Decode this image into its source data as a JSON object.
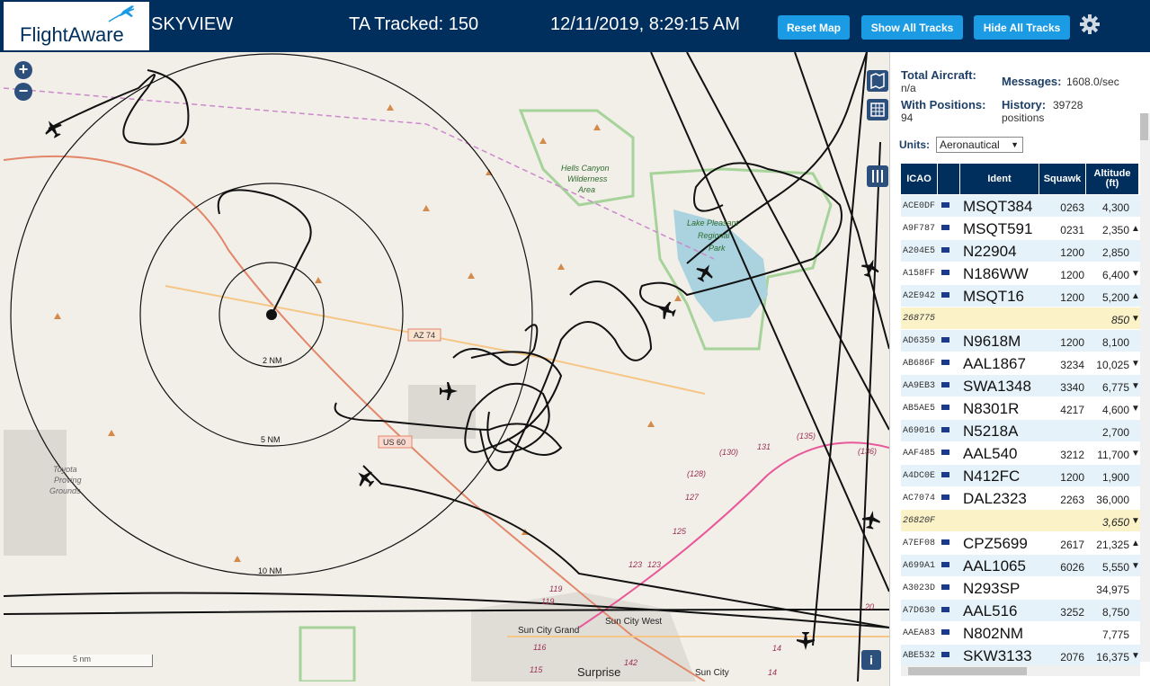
{
  "header": {
    "logo": "FlightAware",
    "site_name": "SKYVIEW",
    "tracked": "TA Tracked: 150",
    "datetime": "12/11/2019, 8:29:15 AM",
    "buttons": {
      "reset_map": "Reset Map",
      "show_all_tracks": "Show All Tracks",
      "hide_all_tracks": "Hide All Tracks"
    }
  },
  "map": {
    "range_rings": [
      "2 NM",
      "5 NM",
      "10 NM"
    ],
    "scale": "5 nm",
    "labels": {
      "hells_canyon": [
        "Hells Canyon",
        "Wilderness",
        "Area"
      ],
      "lake_pleasant": [
        "Lake Pleasant",
        "Regional",
        "Park"
      ],
      "toyota": [
        "Toyota",
        "Proving",
        "Grounds"
      ],
      "az74": "AZ 74",
      "us60": "US 60",
      "sun_city_grand": "Sun City Grand",
      "sun_city_west": "Sun City West",
      "surprise": "Surprise",
      "sun_city": "Sun City",
      "r119a": "119",
      "r119b": "119",
      "r116": "116",
      "r115": "115",
      "r142": "142",
      "r123a": "123",
      "r123b": "123",
      "r125": "125",
      "r127": "127",
      "r128": "(128)",
      "r130": "(130)",
      "r131": "131",
      "r135": "(135)",
      "r136": "(136)",
      "r14a": "14",
      "r14b": "14",
      "r20": "20"
    },
    "info_icon": "i"
  },
  "panel": {
    "total_aircraft_label": "Total Aircraft:",
    "total_aircraft_value": "n/a",
    "messages_label": "Messages:",
    "messages_value": "1608.0/sec",
    "with_positions_label": "With Positions:",
    "with_positions_value": "94",
    "history_label": "History:",
    "history_value_1": "39728",
    "history_value_2": "positions",
    "units_label": "Units:",
    "units_value": "Aeronautical"
  },
  "table": {
    "headers": {
      "icao": "ICAO",
      "ident": "Ident",
      "squawk": "Squawk",
      "altitude": "Altitude (ft)"
    },
    "rows": [
      {
        "icao": "ACE0DF",
        "flag": true,
        "ident": "MSQT384",
        "squawk": "0263",
        "altitude": "4,300",
        "trend": ""
      },
      {
        "icao": "A9F787",
        "flag": true,
        "ident": "MSQT591",
        "squawk": "0231",
        "altitude": "2,350",
        "trend": "▲"
      },
      {
        "icao": "A204E5",
        "flag": true,
        "ident": "N22904",
        "squawk": "1200",
        "altitude": "2,850",
        "trend": ""
      },
      {
        "icao": "A158FF",
        "flag": true,
        "ident": "N186WW",
        "squawk": "1200",
        "altitude": "6,400",
        "trend": "▼"
      },
      {
        "icao": "A2E942",
        "flag": true,
        "ident": "MSQT16",
        "squawk": "1200",
        "altitude": "5,200",
        "trend": "▲"
      },
      {
        "icao": "268775",
        "flag": false,
        "ident": "",
        "squawk": "",
        "altitude": "850",
        "trend": "▼"
      },
      {
        "icao": "AD6359",
        "flag": true,
        "ident": "N9618M",
        "squawk": "1200",
        "altitude": "8,100",
        "trend": ""
      },
      {
        "icao": "AB686F",
        "flag": true,
        "ident": "AAL1867",
        "squawk": "3234",
        "altitude": "10,025",
        "trend": "▼"
      },
      {
        "icao": "AA9EB3",
        "flag": true,
        "ident": "SWA1348",
        "squawk": "3340",
        "altitude": "6,775",
        "trend": "▼"
      },
      {
        "icao": "AB5AE5",
        "flag": true,
        "ident": "N8301R",
        "squawk": "4217",
        "altitude": "4,600",
        "trend": "▼"
      },
      {
        "icao": "A69016",
        "flag": true,
        "ident": "N5218A",
        "squawk": "",
        "altitude": "2,700",
        "trend": ""
      },
      {
        "icao": "AAF485",
        "flag": true,
        "ident": "AAL540",
        "squawk": "3212",
        "altitude": "11,700",
        "trend": "▼"
      },
      {
        "icao": "A4DC0E",
        "flag": true,
        "ident": "N412FC",
        "squawk": "1200",
        "altitude": "1,900",
        "trend": ""
      },
      {
        "icao": "AC7074",
        "flag": true,
        "ident": "DAL2323",
        "squawk": "2263",
        "altitude": "36,000",
        "trend": ""
      },
      {
        "icao": "26820F",
        "flag": false,
        "ident": "",
        "squawk": "",
        "altitude": "3,650",
        "trend": "▼"
      },
      {
        "icao": "A7EF08",
        "flag": true,
        "ident": "CPZ5699",
        "squawk": "2617",
        "altitude": "21,325",
        "trend": "▲"
      },
      {
        "icao": "A699A1",
        "flag": true,
        "ident": "AAL1065",
        "squawk": "6026",
        "altitude": "5,550",
        "trend": "▼"
      },
      {
        "icao": "A3023D",
        "flag": true,
        "ident": "N293SP",
        "squawk": "",
        "altitude": "34,975",
        "trend": ""
      },
      {
        "icao": "A7D630",
        "flag": true,
        "ident": "AAL516",
        "squawk": "3252",
        "altitude": "8,750",
        "trend": ""
      },
      {
        "icao": "AAEA83",
        "flag": true,
        "ident": "N802NM",
        "squawk": "",
        "altitude": "7,775",
        "trend": ""
      },
      {
        "icao": "ABE532",
        "flag": true,
        "ident": "SKW3133",
        "squawk": "2076",
        "altitude": "16,375",
        "trend": "▼"
      }
    ]
  },
  "colors": {
    "header_bg": "#002f5d",
    "button_bg": "#1a9be3",
    "table_head_bg": "#002f5d",
    "row_alt_bg": "#e6f2fa",
    "row_noident_bg": "#fbf2c8"
  },
  "icons": [
    "plane-logo-icon",
    "gear-icon",
    "zoom-in-icon",
    "zoom-out-icon",
    "map-layers-icon",
    "grid-icon",
    "columns-icon",
    "info-icon",
    "aircraft-icon",
    "us-flag-icon"
  ]
}
